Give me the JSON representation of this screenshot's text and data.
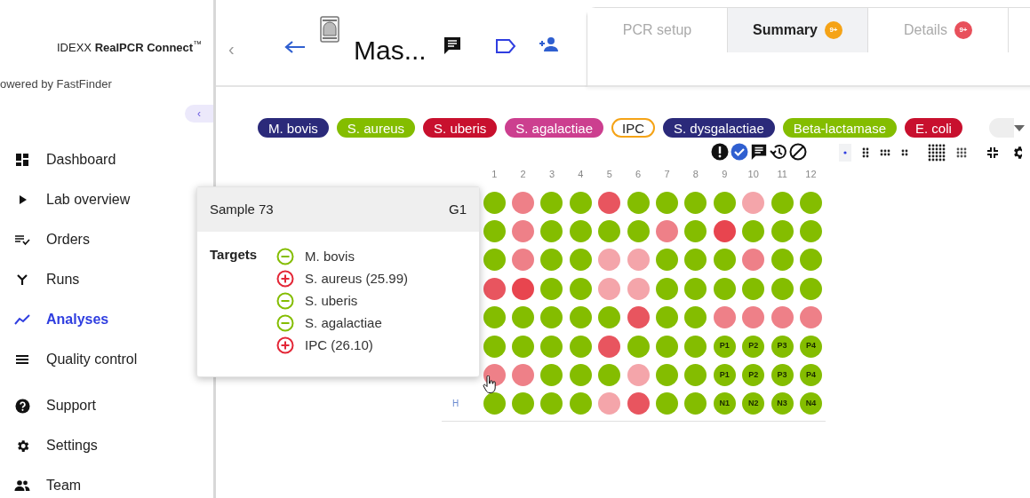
{
  "sidebar": {
    "logo": "IDEXX **RealPCR Connect**$^{™}$",
    "subtitle": "owered by FastFinder",
    "collapse": "‹",
    "items": [
      {
        "label": "Dashboard",
        "kind": "dashboard",
        "selected": false
      },
      {
        "label": "Lab overview",
        "kind": "play",
        "selected": false
      },
      {
        "label": "Orders",
        "kind": "orders",
        "selected": false
      },
      {
        "label": "Runs",
        "kind": "runs",
        "selected": false
      },
      {
        "label": "Analyses",
        "kind": "chart",
        "selected": true
      },
      {
        "label": "Quality control",
        "kind": "lines",
        "selected": false
      }
    ],
    "bottom_items": [
      {
        "label": "Support",
        "kind": "help",
        "selected": false
      },
      {
        "label": "Settings",
        "kind": "gear",
        "selected": false
      },
      {
        "label": "Team",
        "kind": "team",
        "selected": false
      }
    ]
  },
  "header": {
    "collapse": "‹",
    "title": "Mas...",
    "tabs": [
      {
        "label": "PCR setup",
        "selected": false
      },
      {
        "label": "Summary",
        "selected": true,
        "badge": "9+",
        "color": "#f5a316"
      },
      {
        "label": "Details",
        "selected": false,
        "badge": "9+",
        "color": "#e8505b"
      }
    ]
  },
  "targets": [
    {
      "label": "M. bovis",
      "color": "#2b2a7a",
      "outlined": false
    },
    {
      "label": "S. aureus",
      "color": "#84bd00",
      "outlined": false
    },
    {
      "label": "S. uberis",
      "color": "#c8102e",
      "outlined": false
    },
    {
      "label": "S. agalactiae",
      "color": "#cc3f8f",
      "outlined": false
    },
    {
      "label": "IPC",
      "color": "#f5a316",
      "outlined": true
    },
    {
      "label": "S. dysgalactiae",
      "color": "#2b2a7a",
      "outlined": false
    },
    {
      "label": "Beta-lactamase",
      "color": "#84bd00",
      "outlined": false
    },
    {
      "label": "E. coli",
      "color": "#c8102e",
      "outlined": false
    }
  ],
  "plate": {
    "columns": [
      "1",
      "2",
      "3",
      "4",
      "5",
      "6",
      "7",
      "8",
      "9",
      "10",
      "11",
      "12"
    ],
    "rows": [
      {
        "wells": [
          {
            "color": "#84bd00"
          },
          {
            "color": "#ee8088"
          },
          {
            "color": "#84bd00"
          },
          {
            "color": "#84bd00"
          },
          {
            "color": "#e8555f"
          },
          {
            "color": "#84bd00"
          },
          {
            "color": "#84bd00"
          },
          {
            "color": "#84bd00"
          },
          {
            "color": "#84bd00"
          },
          {
            "color": "#f4a5aa"
          },
          {
            "color": "#84bd00"
          },
          {
            "color": "#84bd00"
          }
        ]
      },
      {
        "wells": [
          {
            "color": "#84bd00"
          },
          {
            "color": "#ee8088"
          },
          {
            "color": "#84bd00"
          },
          {
            "color": "#84bd00"
          },
          {
            "color": "#84bd00"
          },
          {
            "color": "#84bd00"
          },
          {
            "color": "#ee8088"
          },
          {
            "color": "#84bd00"
          },
          {
            "color": "#e8454f"
          },
          {
            "color": "#84bd00"
          },
          {
            "color": "#84bd00"
          },
          {
            "color": "#84bd00"
          }
        ]
      },
      {
        "wells": [
          {
            "color": "#84bd00"
          },
          {
            "color": "#ee8088"
          },
          {
            "color": "#84bd00"
          },
          {
            "color": "#84bd00"
          },
          {
            "color": "#f4a5aa"
          },
          {
            "color": "#f4a5aa"
          },
          {
            "color": "#84bd00"
          },
          {
            "color": "#84bd00"
          },
          {
            "color": "#84bd00"
          },
          {
            "color": "#ee8088"
          },
          {
            "color": "#84bd00"
          },
          {
            "color": "#84bd00"
          }
        ]
      },
      {
        "wells": [
          {
            "color": "#e8555f"
          },
          {
            "color": "#e8454f"
          },
          {
            "color": "#84bd00"
          },
          {
            "color": "#84bd00"
          },
          {
            "color": "#f4a5aa"
          },
          {
            "color": "#f4a5aa"
          },
          {
            "color": "#84bd00"
          },
          {
            "color": "#84bd00"
          },
          {
            "color": "#84bd00"
          },
          {
            "color": "#84bd00"
          },
          {
            "color": "#84bd00"
          },
          {
            "color": "#84bd00"
          }
        ]
      },
      {
        "wells": [
          {
            "color": "#84bd00"
          },
          {
            "color": "#84bd00"
          },
          {
            "color": "#84bd00"
          },
          {
            "color": "#84bd00"
          },
          {
            "color": "#84bd00"
          },
          {
            "color": "#e8555f"
          },
          {
            "color": "#84bd00"
          },
          {
            "color": "#84bd00"
          },
          {
            "color": "#ee8088"
          },
          {
            "color": "#ee8088"
          },
          {
            "color": "#ee8088"
          },
          {
            "color": "#ee8088"
          }
        ]
      },
      {
        "wells": [
          {
            "color": "#84bd00"
          },
          {
            "color": "#84bd00"
          },
          {
            "color": "#84bd00"
          },
          {
            "color": "#84bd00"
          },
          {
            "color": "#e8555f"
          },
          {
            "color": "#84bd00"
          },
          {
            "color": "#84bd00"
          },
          {
            "color": "#84bd00"
          },
          {
            "color": "#84bd00",
            "label": "P1"
          },
          {
            "color": "#84bd00",
            "label": "P2"
          },
          {
            "color": "#84bd00",
            "label": "P3"
          },
          {
            "color": "#84bd00",
            "label": "P4"
          }
        ]
      },
      {
        "wells": [
          {
            "color": "#ee8088"
          },
          {
            "color": "#ee8088"
          },
          {
            "color": "#84bd00"
          },
          {
            "color": "#84bd00"
          },
          {
            "color": "#84bd00"
          },
          {
            "color": "#f4a5aa"
          },
          {
            "color": "#84bd00"
          },
          {
            "color": "#84bd00"
          },
          {
            "color": "#84bd00",
            "label": "P1"
          },
          {
            "color": "#84bd00",
            "label": "P2"
          },
          {
            "color": "#84bd00",
            "label": "P3"
          },
          {
            "color": "#84bd00",
            "label": "P4"
          }
        ]
      },
      {
        "label": "H",
        "wells": [
          {
            "color": "#84bd00"
          },
          {
            "color": "#84bd00"
          },
          {
            "color": "#84bd00"
          },
          {
            "color": "#84bd00"
          },
          {
            "color": "#f4a5aa"
          },
          {
            "color": "#e8555f"
          },
          {
            "color": "#84bd00"
          },
          {
            "color": "#84bd00"
          },
          {
            "color": "#84bd00",
            "label": "N1"
          },
          {
            "color": "#84bd00",
            "label": "N2"
          },
          {
            "color": "#84bd00",
            "label": "N3"
          },
          {
            "color": "#84bd00",
            "label": "N4"
          }
        ]
      }
    ]
  },
  "tooltip": {
    "sample": "Sample 73",
    "well": "G1",
    "targets_label": "Targets",
    "results": [
      {
        "kind": "negative",
        "label": "M. bovis"
      },
      {
        "kind": "positive",
        "label": "S. aureus (25.99)"
      },
      {
        "kind": "negative",
        "label": "S. uberis"
      },
      {
        "kind": "negative",
        "label": "S. agalactiae"
      },
      {
        "kind": "positive",
        "label": "IPC (26.10)"
      }
    ]
  }
}
